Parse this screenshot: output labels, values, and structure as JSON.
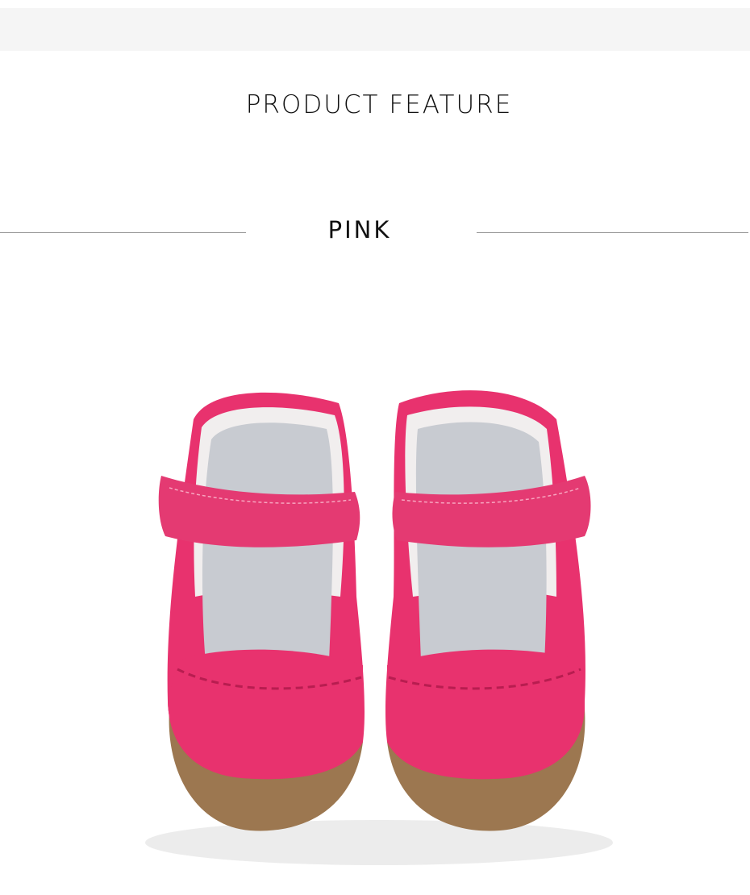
{
  "header": {
    "title": "PRODUCT FEATURE"
  },
  "variant": {
    "color_name": "PINK"
  },
  "product_image": {
    "alt": "Pink leather mary jane baby shoes with hook-and-loop strap"
  },
  "colors": {
    "leather": "#e8326e",
    "insole": "#c8cbd1",
    "sole": "#9c7750",
    "lining": "#f1eeee"
  }
}
